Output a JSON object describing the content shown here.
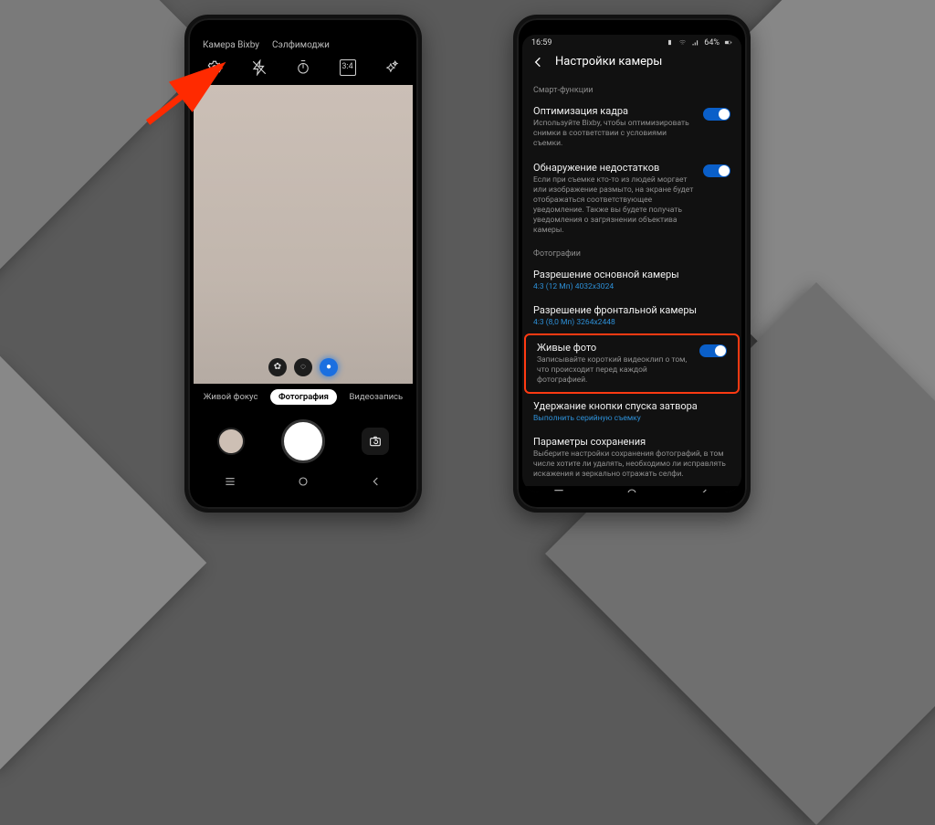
{
  "left": {
    "tabs": {
      "bixby": "Камера Bixby",
      "selfie": "Сэлфимоджи"
    },
    "tools": {
      "settings": "gear-icon",
      "flash": "flash-icon",
      "timer": "timer-off-icon",
      "ratio": "3:4",
      "effects": "effects-icon"
    },
    "modes": {
      "live": "Живой фокус",
      "photo": "Фотография",
      "video": "Видеозапись"
    }
  },
  "right": {
    "status": {
      "time": "16:59",
      "battery": "64%"
    },
    "header": "Настройки камеры",
    "section1": "Смарт-функции",
    "opt_title": "Оптимизация кадра",
    "opt_sub": "Используйте Bixby, чтобы оптимизировать снимки в соответствии с условиями съемки.",
    "flaw_title": "Обнаружение недостатков",
    "flaw_sub": "Если при съемке кто-то из людей моргает или изображение размыто, на экране будет отображаться соответствующее уведомление. Также вы будете получать уведомления о загрязнении объектива камеры.",
    "section2": "Фотографии",
    "res_main_t": "Разрешение основной камеры",
    "res_main_v": "4:3 (12 Мп) 4032x3024",
    "res_front_t": "Разрешение фронтальной камеры",
    "res_front_v": "4:3 (8,0 Мп) 3264x2448",
    "live_t": "Живые фото",
    "live_sub": "Записывайте короткий видеоклип о том, что происходит перед каждой фотографией.",
    "hold_t": "Удержание кнопки спуска затвора",
    "hold_v": "Выполнить серийную съемку",
    "save_t": "Параметры сохранения",
    "save_sub": "Выберите настройки сохранения фотографий, в том числе хотите ли удалять, необходимо ли исправлять искажения и зеркально отражать селфи."
  }
}
